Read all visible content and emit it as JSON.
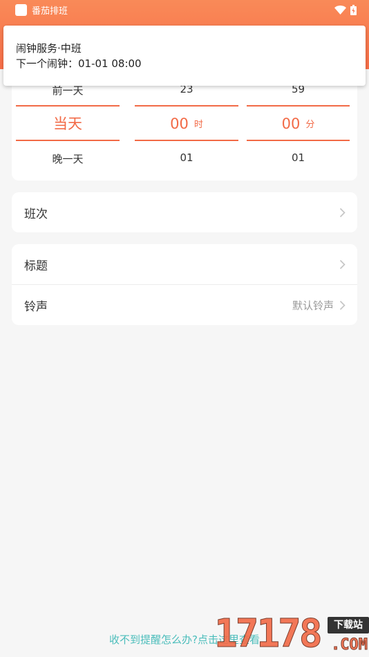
{
  "status_bar": {
    "app_name": "番茄排班",
    "icons": [
      "wifi-icon",
      "battery-icon"
    ],
    "color": "#f86e48"
  },
  "notification": {
    "title": "闹钟服务·中班",
    "next_alarm": "下一个闹钟：01-01 08:00"
  },
  "picker": {
    "day": {
      "prev": "前一天",
      "selected": "当天",
      "next": "晚一天"
    },
    "hour": {
      "prev": "23",
      "selected": "00",
      "unit": "时",
      "next": "01"
    },
    "minute": {
      "prev": "59",
      "selected": "00",
      "unit": "分",
      "next": "01"
    },
    "accent_color": "#f26a46"
  },
  "settings": {
    "shift_label": "班次",
    "title_label": "标题",
    "ringtone_label": "铃声",
    "ringtone_value": "默认铃声"
  },
  "footer": {
    "help_link": "收不到提醒怎么办?点击这里查看",
    "link_color": "#4bbdbb"
  },
  "watermark": {
    "number": "17178",
    "tag": "下载站",
    "suffix": ".COM"
  }
}
